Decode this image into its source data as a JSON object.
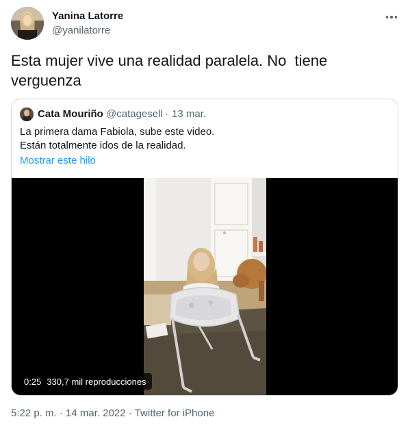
{
  "author": {
    "name": "Yanina Latorre",
    "handle": "@yanilatorre"
  },
  "tweet": {
    "text": "Esta mujer vive una realidad paralela. No  tiene\nverguenza"
  },
  "quoted": {
    "name": "Cata Mouriño",
    "handle": "@catagesell",
    "separator": "·",
    "date": "13 mar.",
    "line1": "La primera dama Fabiola, sube este video.",
    "line2": "Están totalmente idos de la realidad.",
    "show_thread": "Mostrar este hilo",
    "video": {
      "duration": "0:25",
      "views": "330,7 mil reproducciones"
    }
  },
  "meta": {
    "time": "5:22 p. m.",
    "separator1": "·",
    "date": "14 mar. 2022",
    "separator2": "·",
    "source": "Twitter for iPhone"
  },
  "colors": {
    "link": "#1d9bf0",
    "secondary_text": "#536471",
    "border": "#cfd9de"
  },
  "icons": {
    "more": "more-horizontal-icon"
  }
}
